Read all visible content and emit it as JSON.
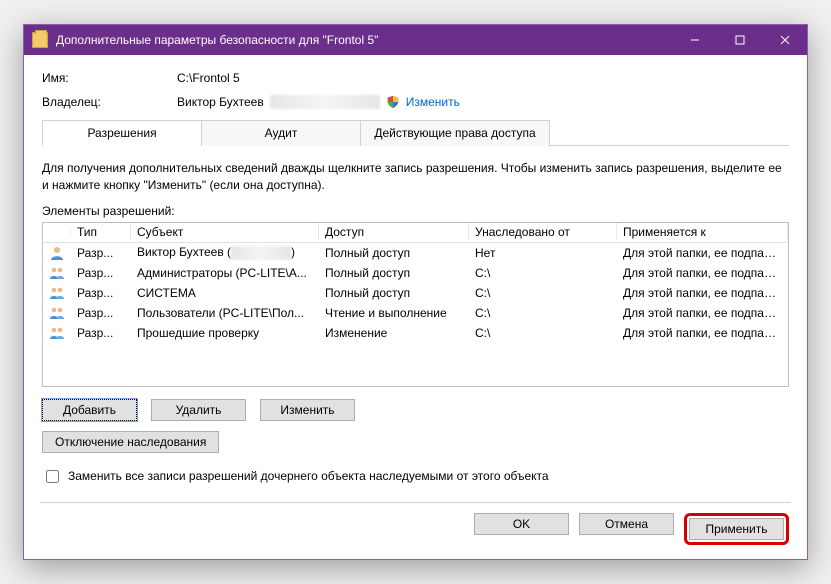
{
  "window": {
    "title": "Дополнительные параметры безопасности  для \"Frontol 5\""
  },
  "info": {
    "name_label": "Имя:",
    "name_value": "C:\\Frontol 5",
    "owner_label": "Владелец:",
    "owner_value": "Виктор Бухтеев",
    "change_link": "Изменить"
  },
  "tabs": {
    "permissions": "Разрешения",
    "audit": "Аудит",
    "effective": "Действующие права доступа"
  },
  "help_text": "Для получения дополнительных сведений дважды щелкните запись разрешения. Чтобы изменить запись разрешения, выделите ее и нажмите кнопку \"Изменить\" (если она доступна).",
  "perm_elements_label": "Элементы разрешений:",
  "columns": {
    "icon": "",
    "type": "Тип",
    "subject": "Субъект",
    "access": "Доступ",
    "inherited": "Унаследовано от",
    "applies": "Применяется к"
  },
  "rows": [
    {
      "icon": "user",
      "type": "Разр...",
      "subject": "Виктор Бухтеев (",
      "subject_tail": ")",
      "access": "Полный доступ",
      "inherited": "Нет",
      "applies": "Для этой папки, ее подпапок ..."
    },
    {
      "icon": "group",
      "type": "Разр...",
      "subject": "Администраторы (PC-LITE\\А...",
      "subject_tail": "",
      "access": "Полный доступ",
      "inherited": "C:\\",
      "applies": "Для этой папки, ее подпапок ..."
    },
    {
      "icon": "group",
      "type": "Разр...",
      "subject": "СИСТЕМА",
      "subject_tail": "",
      "access": "Полный доступ",
      "inherited": "C:\\",
      "applies": "Для этой папки, ее подпапок ..."
    },
    {
      "icon": "group",
      "type": "Разр...",
      "subject": "Пользователи (PC-LITE\\Пол...",
      "subject_tail": "",
      "access": "Чтение и выполнение",
      "inherited": "C:\\",
      "applies": "Для этой папки, ее подпапок ..."
    },
    {
      "icon": "group",
      "type": "Разр...",
      "subject": "Прошедшие проверку",
      "subject_tail": "",
      "access": "Изменение",
      "inherited": "C:\\",
      "applies": "Для этой папки, ее подпапок ..."
    }
  ],
  "buttons": {
    "add": "Добавить",
    "remove": "Удалить",
    "edit": "Изменить",
    "disable_inherit": "Отключение наследования",
    "replace_checkbox": "Заменить все записи разрешений дочернего объекта наследуемыми от этого объекта",
    "ok": "OK",
    "cancel": "Отмена",
    "apply": "Применить"
  }
}
